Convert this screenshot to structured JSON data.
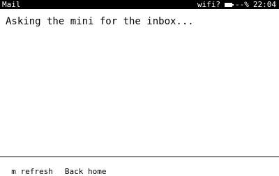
{
  "status_bar": {
    "app_title": "Mail",
    "wifi": "wifi?",
    "battery": "--%",
    "clock": "22:04",
    "icon": "battery-icon"
  },
  "main": {
    "message": "Asking the mini for the inbox..."
  },
  "footer": {
    "refresh_hint": "m refresh",
    "back_hint": "Back home"
  },
  "colors": {
    "background": "#ffffff",
    "foreground": "#000000"
  }
}
